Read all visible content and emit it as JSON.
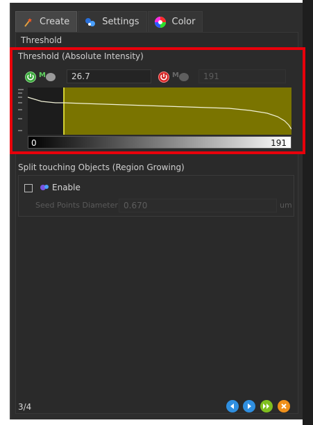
{
  "tabs": [
    {
      "label": "Create",
      "icon": "wand-icon"
    },
    {
      "label": "Settings",
      "icon": "settings-molecule-icon"
    },
    {
      "label": "Color",
      "icon": "color-wheel-icon"
    }
  ],
  "threshold": {
    "section_label": "Threshold",
    "box_title": "Threshold (Absolute Intensity)",
    "low_value": "26.7",
    "high_value": "191",
    "scale_min": "0",
    "scale_max": "191",
    "auto_low_badge": "M",
    "auto_high_badge": "M"
  },
  "split": {
    "section_label": "Split touching Objects (Region Growing)",
    "enable_label": "Enable",
    "enabled": false,
    "seed_label": "Seed Points Diameter",
    "seed_value": "0.670",
    "seed_unit": "um"
  },
  "footer": {
    "page": "3/4"
  },
  "colors": {
    "accent_red": "#e8000b",
    "histogram_fill": "#7a7400",
    "nav_blue": "#2f8fe0",
    "nav_green": "#7fbf1f",
    "nav_orange": "#f0901a"
  }
}
